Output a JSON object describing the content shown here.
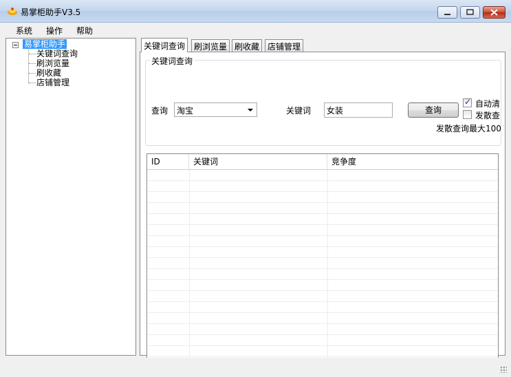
{
  "window": {
    "title": "易掌柜助手V3.5"
  },
  "menu": {
    "items": [
      "系统",
      "操作",
      "帮助"
    ]
  },
  "tree": {
    "root": "易掌柜助手",
    "children": [
      "关键词查询",
      "刷浏览量",
      "刷收藏",
      "店铺管理"
    ]
  },
  "tabs": [
    "关键词查询",
    "刷浏览量",
    "刷收藏",
    "店铺管理"
  ],
  "keyword_panel": {
    "group_title": "关键词查询",
    "query_label": "查询",
    "query_selected": "淘宝",
    "keyword_label": "关键词",
    "keyword_value": "女装",
    "query_button": "查询",
    "auto_clear_label": "自动清",
    "auto_clear_checked": true,
    "spread_query_label": "发散查",
    "spread_query_checked": false,
    "spread_note": "发散查询最大100"
  },
  "grid": {
    "columns": [
      "ID",
      "关键词",
      "竞争度"
    ]
  }
}
